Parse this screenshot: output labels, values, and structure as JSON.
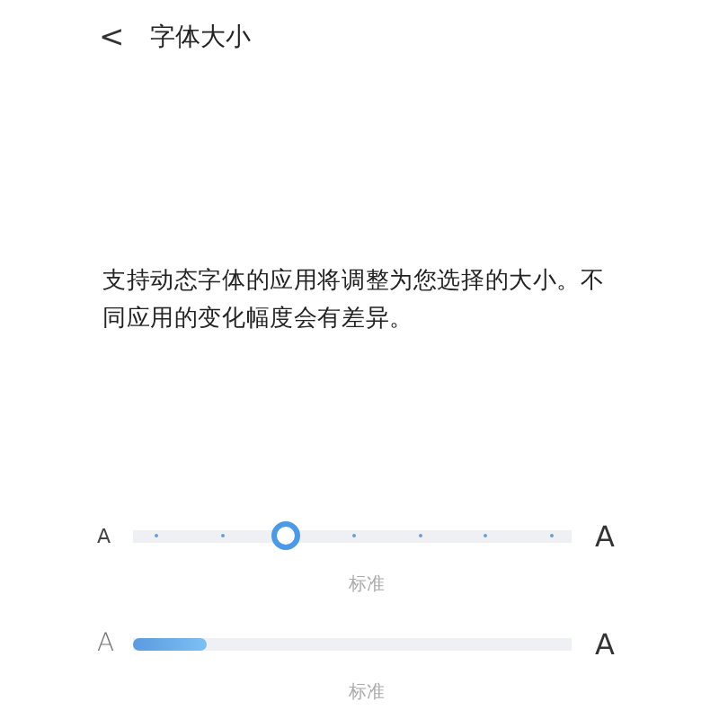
{
  "header": {
    "back": "<",
    "title": "字体大小"
  },
  "description": "支持动态字体的应用将调整为您选择的大小。不同应用的变化幅度会有差异。",
  "sliders": [
    {
      "kind": "stepped",
      "min_label": "A",
      "max_label": "A",
      "level": 0.333,
      "caption": "标准"
    },
    {
      "kind": "continuous",
      "min_label": "A",
      "max_label": "A",
      "level": 0.17,
      "caption": "标准"
    }
  ]
}
